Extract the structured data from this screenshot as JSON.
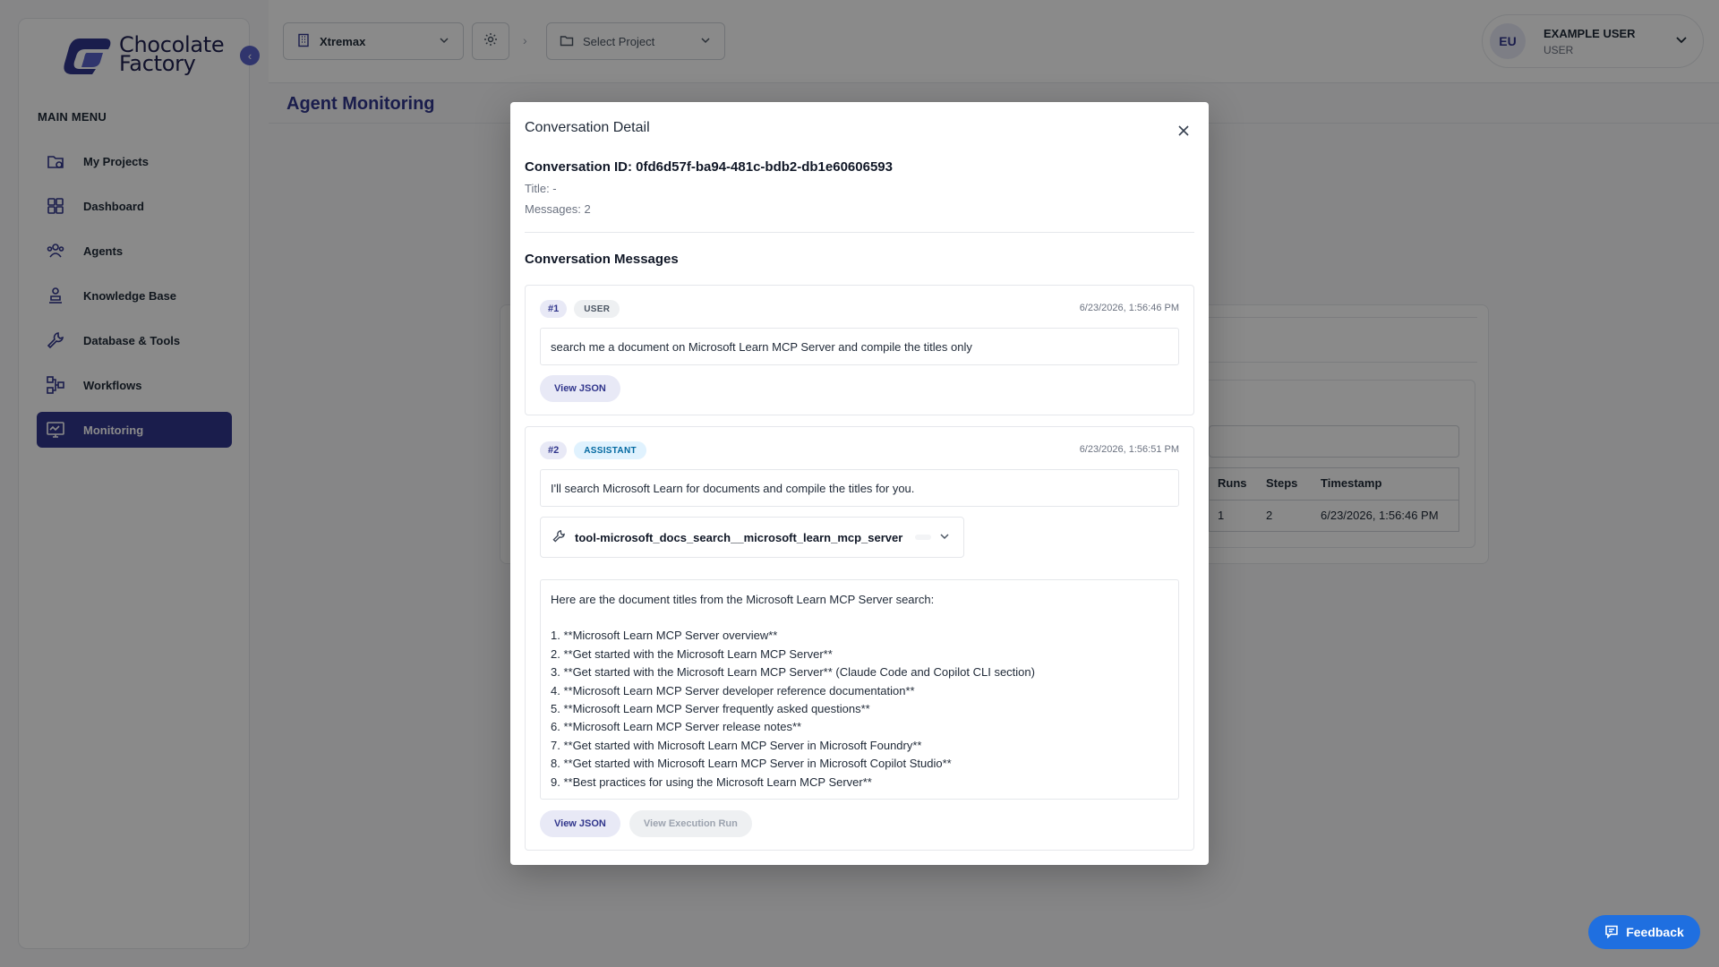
{
  "brand": {
    "line1": "Chocolate",
    "line2": "Factory"
  },
  "sidebar": {
    "menu_title": "MAIN MENU",
    "items": [
      {
        "label": "My Projects",
        "icon": "projects-icon"
      },
      {
        "label": "Dashboard",
        "icon": "dashboard-icon"
      },
      {
        "label": "Agents",
        "icon": "agents-icon"
      },
      {
        "label": "Knowledge Base",
        "icon": "knowledge-icon"
      },
      {
        "label": "Database & Tools",
        "icon": "tools-icon"
      },
      {
        "label": "Workflows",
        "icon": "workflows-icon"
      },
      {
        "label": "Monitoring",
        "icon": "monitoring-icon",
        "active": true
      }
    ]
  },
  "topbar": {
    "workspace": "Xtremax",
    "project_placeholder": "Select Project",
    "user": {
      "initials": "EU",
      "name": "EXAMPLE USER",
      "role": "USER"
    }
  },
  "page": {
    "title": "Agent Monitoring"
  },
  "background_table": {
    "headers": [
      "Runs",
      "Steps",
      "Timestamp"
    ],
    "row": [
      "1",
      "2",
      "6/23/2026, 1:56:46 PM"
    ]
  },
  "modal": {
    "title": "Conversation Detail",
    "conversation_id": "Conversation ID: 0fd6d57f-ba94-481c-bdb2-db1e60606593",
    "title_line": "Title: -",
    "messages_line": "Messages: 2",
    "section_title": "Conversation Messages",
    "messages": [
      {
        "index": "#1",
        "role": "USER",
        "timestamp": "6/23/2026, 1:56:46 PM",
        "content": "search me a document on Microsoft Learn MCP Server and compile the titles only",
        "view_json": "View JSON"
      },
      {
        "index": "#2",
        "role": "ASSISTANT",
        "timestamp": "6/23/2026, 1:56:51 PM",
        "content": "I'll search Microsoft Learn for documents and compile the titles for you.",
        "tool": "tool-microsoft_docs_search__microsoft_learn_mcp_server",
        "response_intro": "Here are the document titles from the Microsoft Learn MCP Server search:",
        "response_items": [
          "1. **Microsoft Learn MCP Server overview**",
          "2. **Get started with the Microsoft Learn MCP Server**",
          "3. **Get started with the Microsoft Learn MCP Server** (Claude Code and Copilot CLI section)",
          "4. **Microsoft Learn MCP Server developer reference documentation**",
          "5. **Microsoft Learn MCP Server frequently asked questions**",
          "6. **Microsoft Learn MCP Server release notes**",
          "7. **Get started with Microsoft Learn MCP Server in Microsoft Foundry**",
          "8. **Get started with Microsoft Learn MCP Server in Microsoft Copilot Studio**",
          "9. **Best practices for using the Microsoft Learn MCP Server**"
        ],
        "view_json": "View JSON",
        "view_run": "View Execution Run"
      }
    ]
  },
  "feedback": {
    "label": "Feedback"
  },
  "colors": {
    "accent": "#31368c",
    "feedback": "#1f6fe0",
    "assistant_badge": "#0369a1"
  }
}
